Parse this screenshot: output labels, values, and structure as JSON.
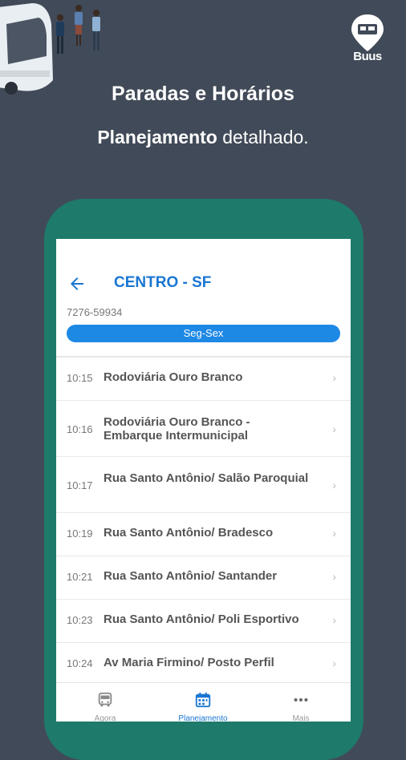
{
  "brand": {
    "logo_text": "Buus"
  },
  "promo": {
    "headline": "Paradas e Horários",
    "sub_bold": "Planejamento",
    "sub_rest": " detalhado."
  },
  "route": {
    "title": "CENTRO - SF",
    "code": "7276-59934",
    "day_filter": "Seg-Sex"
  },
  "stops": [
    {
      "time": "10:15",
      "name": "Rodoviária Ouro Branco"
    },
    {
      "time": "10:16",
      "name": "Rodoviária Ouro Branco - Embarque Intermunicipal"
    },
    {
      "time": "10:17",
      "name": "Rua Santo Antônio/ Salão Paroquial"
    },
    {
      "time": "10:19",
      "name": "Rua Santo Antônio/ Bradesco"
    },
    {
      "time": "10:21",
      "name": "Rua Santo Antônio/ Santander"
    },
    {
      "time": "10:23",
      "name": "Rua Santo Antônio/ Poli Esportivo"
    },
    {
      "time": "10:24",
      "name": "Av Maria Firmino/ Posto Perfil"
    }
  ],
  "nav": {
    "items": [
      {
        "label": "Agora",
        "icon": "bus-icon"
      },
      {
        "label": "Planejamento",
        "icon": "calendar-icon"
      },
      {
        "label": "Mais",
        "icon": "more-icon"
      }
    ]
  },
  "colors": {
    "background": "#414a58",
    "phone_frame": "#1e7a6a",
    "accent": "#1976d2",
    "pill": "#1e88e5"
  }
}
